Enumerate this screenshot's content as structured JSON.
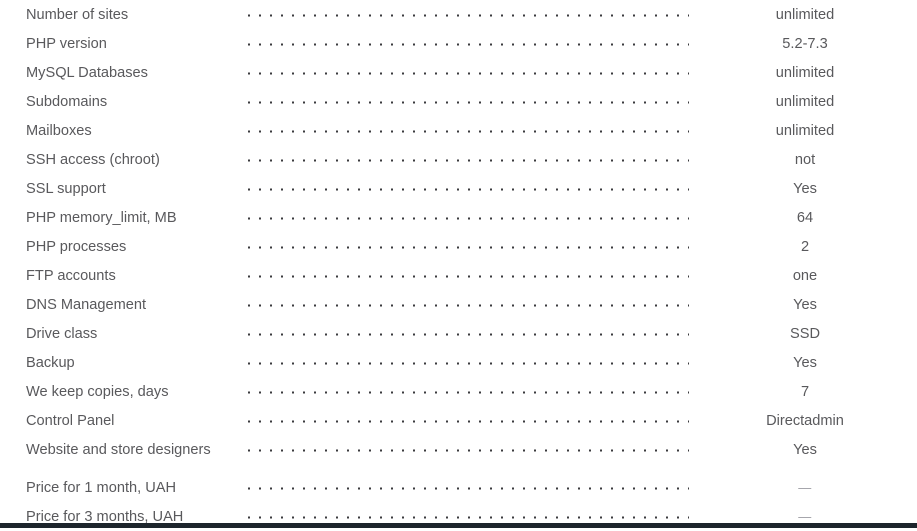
{
  "page": {
    "background_color": "#ffffff",
    "label_color": "#59595c",
    "leader_dot_color": "#3a3a3d",
    "footer_bar_color": "#1d252c"
  },
  "spec_table": {
    "rows": [
      {
        "label": "Number of sites",
        "value": "unlimited",
        "placeholder": false,
        "group_start": false
      },
      {
        "label": "PHP version",
        "value": "5.2-7.3",
        "placeholder": false,
        "group_start": false
      },
      {
        "label": "MySQL Databases",
        "value": "unlimited",
        "placeholder": false,
        "group_start": false
      },
      {
        "label": "Subdomains",
        "value": "unlimited",
        "placeholder": false,
        "group_start": false
      },
      {
        "label": "Mailboxes",
        "value": "unlimited",
        "placeholder": false,
        "group_start": false
      },
      {
        "label": "SSH access (chroot)",
        "value": "not",
        "placeholder": false,
        "group_start": false
      },
      {
        "label": "SSL support",
        "value": "Yes",
        "placeholder": false,
        "group_start": false
      },
      {
        "label": "PHP memory_limit, MB",
        "value": "64",
        "placeholder": false,
        "group_start": false
      },
      {
        "label": "PHP processes",
        "value": "2",
        "placeholder": false,
        "group_start": false
      },
      {
        "label": "FTP accounts",
        "value": "one",
        "placeholder": false,
        "group_start": false
      },
      {
        "label": "DNS Management",
        "value": "Yes",
        "placeholder": false,
        "group_start": false
      },
      {
        "label": "Drive class",
        "value": "SSD",
        "placeholder": false,
        "group_start": false
      },
      {
        "label": "Backup",
        "value": "Yes",
        "placeholder": false,
        "group_start": false
      },
      {
        "label": "We keep copies, days",
        "value": "7",
        "placeholder": false,
        "group_start": false
      },
      {
        "label": "Control Panel",
        "value": "Directadmin",
        "placeholder": false,
        "group_start": false
      },
      {
        "label": "Website and store designers",
        "value": "Yes",
        "placeholder": false,
        "group_start": false
      },
      {
        "label": "Price for 1 month, UAH",
        "value": "—",
        "placeholder": true,
        "group_start": true
      },
      {
        "label": "Price for 3 months, UAH",
        "value": "—",
        "placeholder": true,
        "group_start": false
      }
    ]
  }
}
